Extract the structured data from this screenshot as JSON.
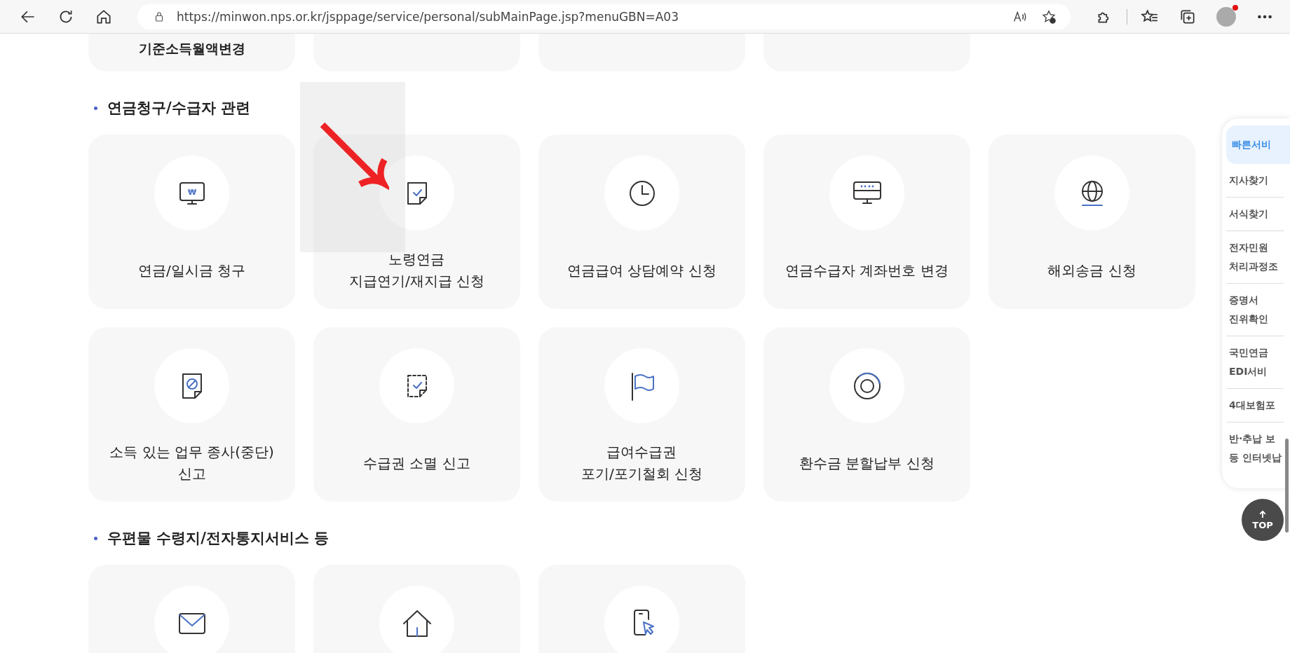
{
  "browser": {
    "url": "https://minwon.nps.or.kr/jsppage/service/personal/subMainPage.jsp?menuGBN=A03"
  },
  "sections": [
    {
      "cards": [
        {
          "label": "기준소득월액변경",
          "kind": "blank"
        },
        {
          "kind": "blank"
        },
        {
          "kind": "blank"
        },
        {
          "kind": "blank"
        }
      ]
    },
    {
      "title": "연금청구/수급자 관련",
      "cards": [
        {
          "label": "연금/일시금 청구",
          "kind": "monitor-won",
          "glyph": "₩"
        },
        {
          "label": "노령연금\n지급연기/재지급 신청",
          "kind": "document-check"
        },
        {
          "label": "연금급여 상담예약 신청",
          "kind": "clock"
        },
        {
          "label": "연금수급자 계좌번호 변경",
          "kind": "monitor-password"
        },
        {
          "label": "해외송금 신청",
          "kind": "globe"
        },
        {
          "label": "소득 있는 업무 종사(중단)\n신고",
          "kind": "document-ban"
        },
        {
          "label": "수급권 소멸 신고",
          "kind": "dashed-check"
        },
        {
          "label": "급여수급권\n포기/포기철회 신청",
          "kind": "flag"
        },
        {
          "label": "환수금 분할납부 신청",
          "kind": "ring"
        }
      ]
    },
    {
      "title": "우편물 수령지/전자통지서비스 등",
      "cards": [
        {
          "kind": "envelope"
        },
        {
          "kind": "house"
        },
        {
          "kind": "phone-tap"
        }
      ]
    }
  ],
  "quick_menu": {
    "items": [
      {
        "label": "빠른서비",
        "selected": true
      },
      {
        "label": "지사찾기",
        "selected": false
      },
      {
        "label": "서식찾기",
        "selected": false
      },
      {
        "label": "전자민원\n처리과정조",
        "selected": false
      },
      {
        "label": "증명서\n진위확인",
        "selected": false
      },
      {
        "label": "국민연금\nEDI서비",
        "selected": false
      },
      {
        "label": "4대보험포",
        "selected": false
      },
      {
        "label": "반·추납 보\n등 인터넷납",
        "selected": false
      }
    ],
    "top_button": "TOP"
  }
}
